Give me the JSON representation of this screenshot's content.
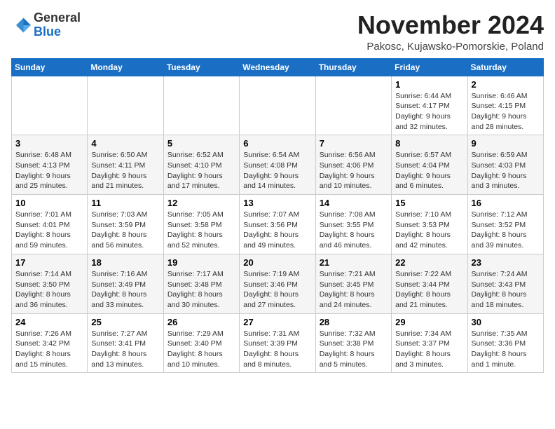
{
  "header": {
    "logo": {
      "general": "General",
      "blue": "Blue"
    },
    "title": "November 2024",
    "location": "Pakosc, Kujawsko-Pomorskie, Poland"
  },
  "calendar": {
    "weekdays": [
      "Sunday",
      "Monday",
      "Tuesday",
      "Wednesday",
      "Thursday",
      "Friday",
      "Saturday"
    ],
    "weeks": [
      [
        {
          "day": "",
          "info": ""
        },
        {
          "day": "",
          "info": ""
        },
        {
          "day": "",
          "info": ""
        },
        {
          "day": "",
          "info": ""
        },
        {
          "day": "",
          "info": ""
        },
        {
          "day": "1",
          "info": "Sunrise: 6:44 AM\nSunset: 4:17 PM\nDaylight: 9 hours\nand 32 minutes."
        },
        {
          "day": "2",
          "info": "Sunrise: 6:46 AM\nSunset: 4:15 PM\nDaylight: 9 hours\nand 28 minutes."
        }
      ],
      [
        {
          "day": "3",
          "info": "Sunrise: 6:48 AM\nSunset: 4:13 PM\nDaylight: 9 hours\nand 25 minutes."
        },
        {
          "day": "4",
          "info": "Sunrise: 6:50 AM\nSunset: 4:11 PM\nDaylight: 9 hours\nand 21 minutes."
        },
        {
          "day": "5",
          "info": "Sunrise: 6:52 AM\nSunset: 4:10 PM\nDaylight: 9 hours\nand 17 minutes."
        },
        {
          "day": "6",
          "info": "Sunrise: 6:54 AM\nSunset: 4:08 PM\nDaylight: 9 hours\nand 14 minutes."
        },
        {
          "day": "7",
          "info": "Sunrise: 6:56 AM\nSunset: 4:06 PM\nDaylight: 9 hours\nand 10 minutes."
        },
        {
          "day": "8",
          "info": "Sunrise: 6:57 AM\nSunset: 4:04 PM\nDaylight: 9 hours\nand 6 minutes."
        },
        {
          "day": "9",
          "info": "Sunrise: 6:59 AM\nSunset: 4:03 PM\nDaylight: 9 hours\nand 3 minutes."
        }
      ],
      [
        {
          "day": "10",
          "info": "Sunrise: 7:01 AM\nSunset: 4:01 PM\nDaylight: 8 hours\nand 59 minutes."
        },
        {
          "day": "11",
          "info": "Sunrise: 7:03 AM\nSunset: 3:59 PM\nDaylight: 8 hours\nand 56 minutes."
        },
        {
          "day": "12",
          "info": "Sunrise: 7:05 AM\nSunset: 3:58 PM\nDaylight: 8 hours\nand 52 minutes."
        },
        {
          "day": "13",
          "info": "Sunrise: 7:07 AM\nSunset: 3:56 PM\nDaylight: 8 hours\nand 49 minutes."
        },
        {
          "day": "14",
          "info": "Sunrise: 7:08 AM\nSunset: 3:55 PM\nDaylight: 8 hours\nand 46 minutes."
        },
        {
          "day": "15",
          "info": "Sunrise: 7:10 AM\nSunset: 3:53 PM\nDaylight: 8 hours\nand 42 minutes."
        },
        {
          "day": "16",
          "info": "Sunrise: 7:12 AM\nSunset: 3:52 PM\nDaylight: 8 hours\nand 39 minutes."
        }
      ],
      [
        {
          "day": "17",
          "info": "Sunrise: 7:14 AM\nSunset: 3:50 PM\nDaylight: 8 hours\nand 36 minutes."
        },
        {
          "day": "18",
          "info": "Sunrise: 7:16 AM\nSunset: 3:49 PM\nDaylight: 8 hours\nand 33 minutes."
        },
        {
          "day": "19",
          "info": "Sunrise: 7:17 AM\nSunset: 3:48 PM\nDaylight: 8 hours\nand 30 minutes."
        },
        {
          "day": "20",
          "info": "Sunrise: 7:19 AM\nSunset: 3:46 PM\nDaylight: 8 hours\nand 27 minutes."
        },
        {
          "day": "21",
          "info": "Sunrise: 7:21 AM\nSunset: 3:45 PM\nDaylight: 8 hours\nand 24 minutes."
        },
        {
          "day": "22",
          "info": "Sunrise: 7:22 AM\nSunset: 3:44 PM\nDaylight: 8 hours\nand 21 minutes."
        },
        {
          "day": "23",
          "info": "Sunrise: 7:24 AM\nSunset: 3:43 PM\nDaylight: 8 hours\nand 18 minutes."
        }
      ],
      [
        {
          "day": "24",
          "info": "Sunrise: 7:26 AM\nSunset: 3:42 PM\nDaylight: 8 hours\nand 15 minutes."
        },
        {
          "day": "25",
          "info": "Sunrise: 7:27 AM\nSunset: 3:41 PM\nDaylight: 8 hours\nand 13 minutes."
        },
        {
          "day": "26",
          "info": "Sunrise: 7:29 AM\nSunset: 3:40 PM\nDaylight: 8 hours\nand 10 minutes."
        },
        {
          "day": "27",
          "info": "Sunrise: 7:31 AM\nSunset: 3:39 PM\nDaylight: 8 hours\nand 8 minutes."
        },
        {
          "day": "28",
          "info": "Sunrise: 7:32 AM\nSunset: 3:38 PM\nDaylight: 8 hours\nand 5 minutes."
        },
        {
          "day": "29",
          "info": "Sunrise: 7:34 AM\nSunset: 3:37 PM\nDaylight: 8 hours\nand 3 minutes."
        },
        {
          "day": "30",
          "info": "Sunrise: 7:35 AM\nSunset: 3:36 PM\nDaylight: 8 hours\nand 1 minute."
        }
      ]
    ]
  }
}
